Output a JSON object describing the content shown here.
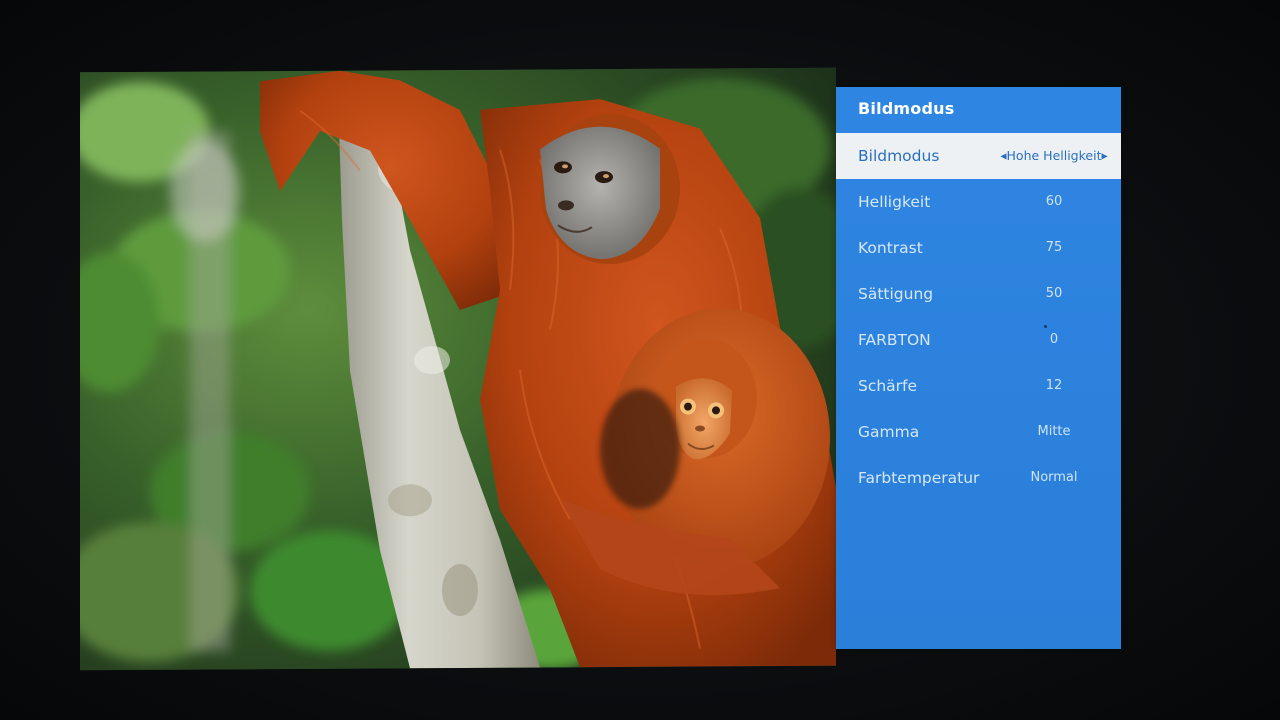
{
  "menu": {
    "title": "Bildmodus",
    "items": [
      {
        "label": "Bildmodus",
        "value": "Hohe Helligkeit",
        "selected": true
      },
      {
        "label": "Helligkeit",
        "value": "60"
      },
      {
        "label": "Kontrast",
        "value": "75"
      },
      {
        "label": "Sättigung",
        "value": "50"
      },
      {
        "label": "FARBTON",
        "value": "0"
      },
      {
        "label": "Schärfe",
        "value": "12"
      },
      {
        "label": "Gamma",
        "value": "Mitte"
      },
      {
        "label": "Farbtemperatur",
        "value": "Normal"
      }
    ],
    "arrow_left": "◀",
    "arrow_right": "▶"
  },
  "colors": {
    "menu_background": "#2b82dd",
    "menu_selected_background": "#eef1f4",
    "menu_selected_text": "#2a6fbf",
    "menu_text": "#d6e7fa"
  }
}
